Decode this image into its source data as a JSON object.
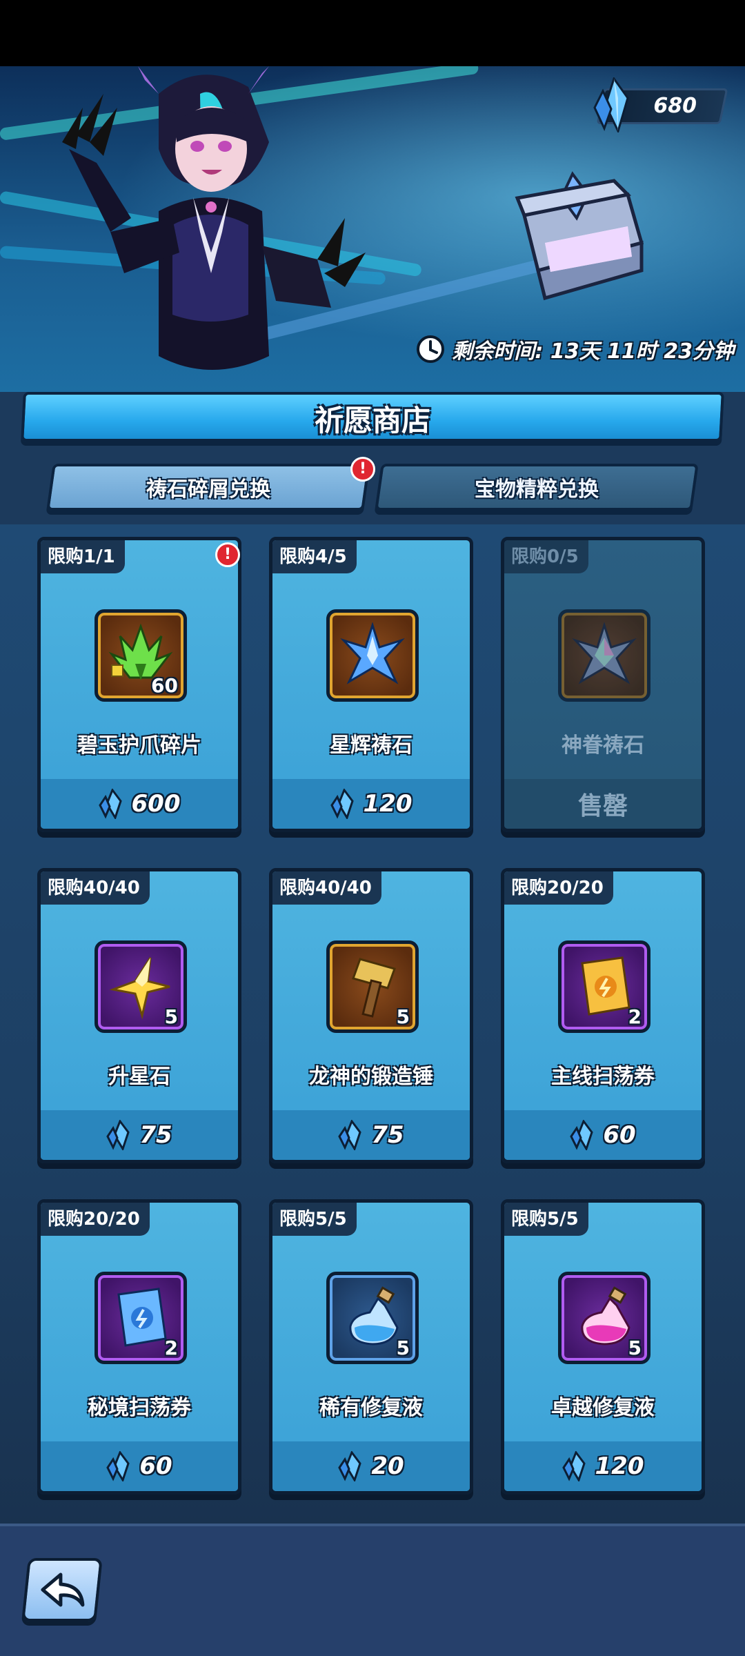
{
  "header": {
    "currency": {
      "icon": "crystal-icon",
      "value": "680"
    },
    "timer": {
      "icon": "clock-icon",
      "text": "剩余时间: 13天 11时 23分钟"
    }
  },
  "shop": {
    "title": "祈愿商店",
    "tabs": [
      {
        "label": "祷石碎屑兑换",
        "active": true,
        "alert": "!"
      },
      {
        "label": "宝物精粹兑换",
        "active": false
      }
    ],
    "items": [
      {
        "limit": "限购1/1",
        "name": "碧玉护爪碎片",
        "icon": "jade-claw-fragment-icon",
        "frame": "gold",
        "quantity": "60",
        "price": "600",
        "alert": "!",
        "sold_out": false
      },
      {
        "limit": "限购4/5",
        "name": "星辉祷石",
        "icon": "starlight-prayer-stone-icon",
        "frame": "gold",
        "quantity": "",
        "price": "120",
        "sold_out": false
      },
      {
        "limit": "限购0/5",
        "name": "神眷祷石",
        "icon": "divine-prayer-stone-icon",
        "frame": "dim",
        "quantity": "",
        "price": "",
        "sold_out": true,
        "sold_out_label": "售罄"
      },
      {
        "limit": "限购40/40",
        "name": "升星石",
        "icon": "star-up-stone-icon",
        "frame": "purple",
        "quantity": "5",
        "price": "75",
        "sold_out": false
      },
      {
        "limit": "限购40/40",
        "name": "龙神的锻造锤",
        "icon": "forge-hammer-icon",
        "frame": "gold",
        "quantity": "5",
        "price": "75",
        "sold_out": false
      },
      {
        "limit": "限购20/20",
        "name": "主线扫荡券",
        "icon": "main-sweep-ticket-icon",
        "frame": "purple",
        "quantity": "2",
        "price": "60",
        "sold_out": false
      },
      {
        "limit": "限购20/20",
        "name": "秘境扫荡券",
        "icon": "secret-realm-sweep-ticket-icon",
        "frame": "purple",
        "quantity": "2",
        "price": "60",
        "sold_out": false
      },
      {
        "limit": "限购5/5",
        "name": "稀有修复液",
        "icon": "rare-repair-potion-icon",
        "frame": "blue",
        "quantity": "5",
        "price": "20",
        "sold_out": false
      },
      {
        "limit": "限购5/5",
        "name": "卓越修复液",
        "icon": "excellent-repair-potion-icon",
        "frame": "purple",
        "quantity": "5",
        "price": "120",
        "sold_out": false
      }
    ]
  },
  "footer": {
    "back_icon": "back-arrow-icon"
  },
  "colors": {
    "accent": "#27a8ec",
    "alert": "#e02630",
    "panel": "#1f4a74"
  }
}
